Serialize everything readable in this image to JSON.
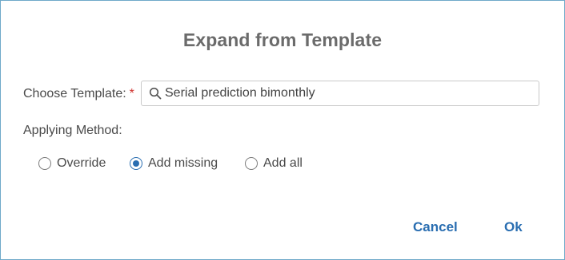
{
  "dialog": {
    "title": "Expand from Template",
    "choose_template_label": "Choose Template:",
    "required_marker": "*",
    "template_value": "Serial prediction bimonthly",
    "applying_method_label": "Applying Method:",
    "methods": [
      {
        "label": "Override",
        "selected": false
      },
      {
        "label": "Add missing",
        "selected": true
      },
      {
        "label": "Add all",
        "selected": false
      }
    ],
    "cancel_label": "Cancel",
    "ok_label": "Ok"
  },
  "colors": {
    "accent": "#2a6eb1",
    "required": "#d0312d",
    "border": "#6fa9c9"
  },
  "icons": {
    "search": "search-icon"
  }
}
